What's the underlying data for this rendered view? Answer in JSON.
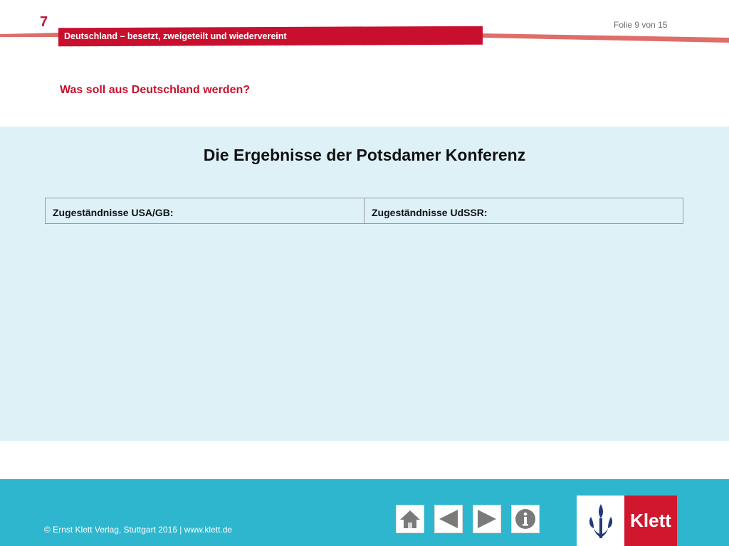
{
  "header": {
    "chapter_number": "7",
    "chapter_title": "Deutschland – besetzt, zweigeteilt und wiedervereint",
    "slide_counter": "Folie 9 von 15"
  },
  "slide": {
    "question": "Was soll aus Deutschland werden?",
    "title": "Die Ergebnisse der Potsdamer Konferenz",
    "table": {
      "columns": [
        "Zugeständnisse USA/GB:",
        "Zugeständnisse UdSSR:"
      ]
    }
  },
  "footer": {
    "copyright": "© Ernst Klett Verlag, Stuttgart 2016 | www.klett.de",
    "nav": [
      {
        "icon": "home-icon"
      },
      {
        "icon": "arrow-left-icon"
      },
      {
        "icon": "arrow-right-icon"
      },
      {
        "icon": "info-icon"
      }
    ],
    "logo_text": "Klett"
  },
  "colors": {
    "accent_red": "#c8102e",
    "panel_blue": "#ddf1f7",
    "footer_blue": "#2eb6cf"
  }
}
